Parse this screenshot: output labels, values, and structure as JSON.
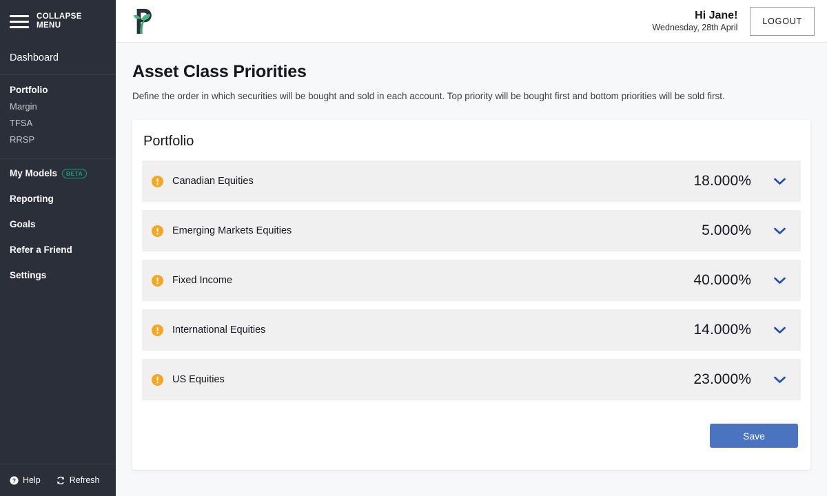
{
  "sidebar": {
    "collapse": {
      "label": "COLLAPSE\nMENU",
      "icon": "hamburger-icon"
    },
    "dashboard": "Dashboard",
    "account_group": {
      "title": "Portfolio",
      "items": [
        "Margin",
        "TFSA",
        "RRSP"
      ]
    },
    "items": [
      {
        "label": "My Models",
        "badge": "BETA"
      },
      {
        "label": "Reporting",
        "badge": ""
      },
      {
        "label": "Goals",
        "badge": ""
      },
      {
        "label": "Refer a Friend",
        "badge": ""
      },
      {
        "label": "Settings",
        "badge": ""
      }
    ],
    "footer": [
      {
        "label": "Help",
        "icon": "question-circle-icon"
      },
      {
        "label": "Refresh",
        "icon": "refresh-icon"
      }
    ]
  },
  "topbar": {
    "logo": "plant-p-logo",
    "greeting": "Hi Jane!",
    "date": "Wednesday, 28th April",
    "logout_label": "LOGOUT"
  },
  "main": {
    "title": "Asset Class Priorities",
    "description": "Define the order in which securities will be bought and sold in each account. Top priority will be bought first and bottom priorities will be sold first.",
    "card": {
      "title": "Portfolio",
      "rows": [
        {
          "label": "Canadian Equities",
          "percent": "18.000%",
          "icon": "warning-icon",
          "chevron": "chevron-down-icon"
        },
        {
          "label": "Emerging Markets Equities",
          "percent": "5.000%",
          "icon": "warning-icon",
          "chevron": "chevron-down-icon"
        },
        {
          "label": "Fixed Income",
          "percent": "40.000%",
          "icon": "warning-icon",
          "chevron": "chevron-down-icon"
        },
        {
          "label": "International Equities",
          "percent": "14.000%",
          "icon": "warning-icon",
          "chevron": "chevron-down-icon"
        },
        {
          "label": "US Equities",
          "percent": "23.000%",
          "icon": "warning-icon",
          "chevron": "chevron-down-icon"
        }
      ],
      "save_label": "Save"
    }
  },
  "colors": {
    "sidebar_bg": "#2b2f3a",
    "accent_blue": "#4a74c0",
    "warning_orange": "#f5a623",
    "beta_green": "#19a27a",
    "row_bg": "#f0f0f0",
    "page_bg": "#f7f8fa"
  }
}
